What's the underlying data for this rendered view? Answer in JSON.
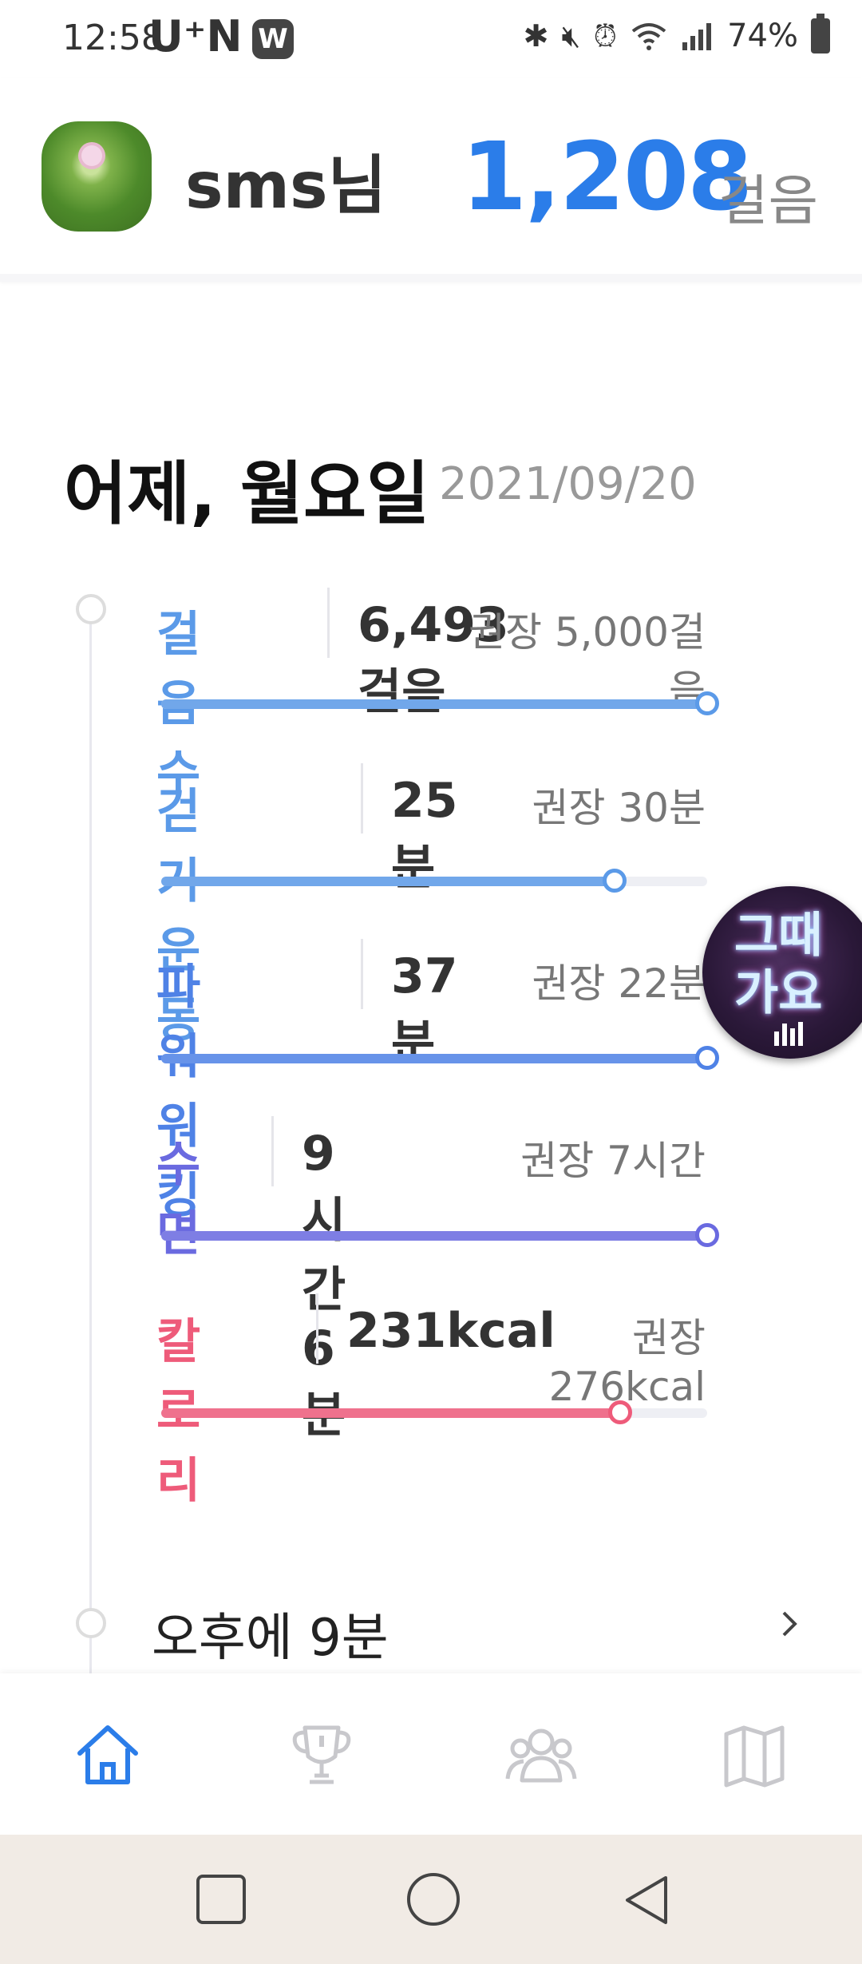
{
  "status_bar": {
    "time": "12:58",
    "carrier": "U⁺N",
    "app_badge": "W",
    "battery": "74%"
  },
  "header": {
    "username": "sms님",
    "steps": "1,208",
    "steps_unit": "걸음"
  },
  "day": {
    "title": "어제, 월요일",
    "date": "2021/09/20"
  },
  "metrics": [
    {
      "label": "걸음 수",
      "value": "6,493걸음",
      "recommended": "권장 5,000걸음",
      "color": "#5b9ae8",
      "progress": 1.0
    },
    {
      "label": "걷기운동",
      "value": "25분",
      "recommended": "권장 30분",
      "color": "#5b9ae8",
      "progress": 0.83
    },
    {
      "label": "파워워킹",
      "value": "37분",
      "recommended": "권장 22분",
      "color": "#4f82e6",
      "progress": 1.0
    },
    {
      "label": "수면",
      "value": "9시간 6분",
      "recommended": "권장 7시간",
      "color": "#6a6ae0",
      "progress": 1.0
    },
    {
      "label": "칼로리",
      "value": "231kcal",
      "recommended": "권장 276kcal",
      "color": "#ee5b7a",
      "progress": 0.84
    }
  ],
  "floating_button": {
    "text_line1": "그때",
    "text_line2": "가요"
  },
  "afternoon": {
    "text": "오후에 9분"
  },
  "bottom_nav": {
    "items": [
      "home-icon",
      "trophy-icon",
      "group-icon",
      "map-icon"
    ],
    "active_color": "#2b7de9",
    "inactive_color": "#c8c8cc"
  }
}
